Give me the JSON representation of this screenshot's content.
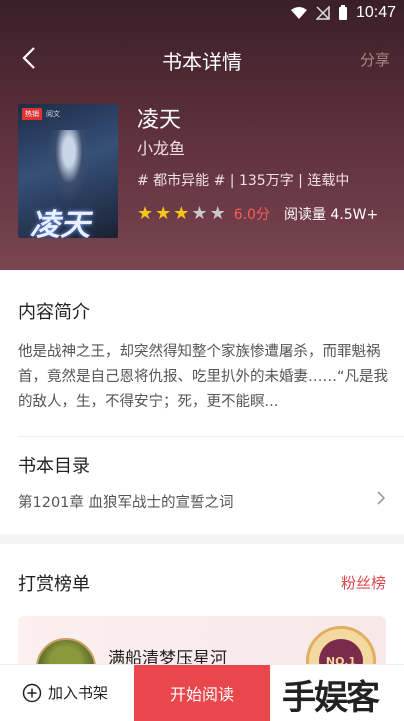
{
  "status": {
    "time": "10:47"
  },
  "nav": {
    "title": "书本详情",
    "share": "分享"
  },
  "book": {
    "cover_tag": "热销",
    "cover_publisher": "阅文",
    "cover_title": "凌天",
    "title": "凌天",
    "author": "小龙鱼",
    "meta": "# 都市异能 # | 135万字 | 连载中",
    "rating_stars": 3,
    "rating_max": 5,
    "score": "6.0分",
    "reads": "阅读量 4.5W+"
  },
  "intro": {
    "heading": "内容简介",
    "text": "他是战神之王，却突然得知整个家族惨遭屠杀，而罪魁祸首，竟然是自己恩将仇报、吃里扒外的未婚妻……“凡是我的敌人，生，不得安宁；死，更不能瞑..."
  },
  "catalog": {
    "heading": "书本目录",
    "latest_chapter": "第1201章 血狼军战士的宣誓之词"
  },
  "reward": {
    "heading": "打赏榜单",
    "fans_link": "粉丝榜",
    "top_user": "满船清梦压星河",
    "badge": "NO.1"
  },
  "bottom": {
    "add_shelf": "加入书架",
    "start_read": "开始阅读",
    "watermark": "手娱客"
  },
  "colors": {
    "accent": "#e9474c",
    "star_on": "#f5c518",
    "star_off": "#c9c9c9",
    "score": "#ff5a5a"
  }
}
